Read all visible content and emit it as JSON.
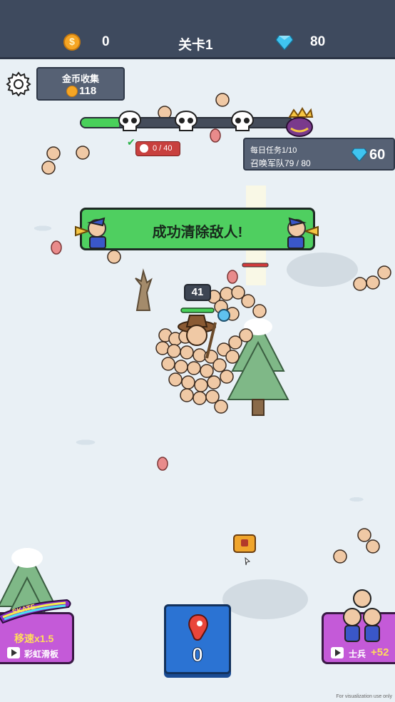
{
  "top_bar": {
    "coins": "0",
    "level": "关卡1",
    "gems": "80"
  },
  "gold_collect": {
    "label": "金币收集",
    "value": "118"
  },
  "daily_task": {
    "title": "每日任务1/10",
    "desc": "召唤军队79 / 80",
    "reward": "60"
  },
  "wave": {
    "kills": "0 / 40",
    "progress": 0.18
  },
  "banner": {
    "message": "成功清除敌人!"
  },
  "player": {
    "army_count": "41"
  },
  "meat_button": {
    "count": "0"
  },
  "skate_button": {
    "badge": "SKATE",
    "speed": "移速x1.5",
    "label": "彩虹滑板"
  },
  "soldier_button": {
    "label": "士兵",
    "bonus": "+52"
  },
  "watermark": "For visualization use only",
  "colors": {
    "banner_green": "#4fcf60",
    "topbar": "#3e4a5e",
    "button_blue": "#2b73d3",
    "button_purple": "#c45ad8"
  }
}
